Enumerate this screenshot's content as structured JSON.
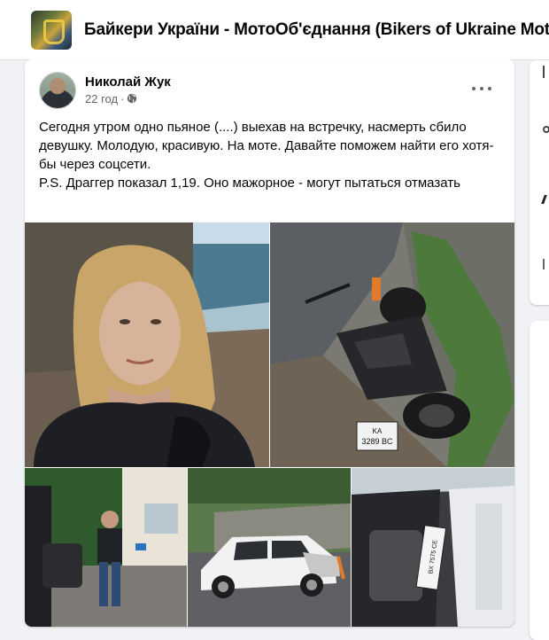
{
  "group": {
    "name": "Байкери України - МотоОб'єднання (Bikers of Ukraine Moto"
  },
  "post": {
    "author": "Николай Жук",
    "time": "22 год",
    "separator": "·",
    "audience_icon": "globe-icon",
    "text_lines": [
      "Сегодня утром одно пьяное (....) выехав на встречку, насмерть сбило девушку. Молодую, красивую. На моте. Давайте поможем найти его хотя-бы через соцсети.",
      "P.S. Драггер показал 1,19. Оно мажорное - могут пытаться отмазать"
    ],
    "photos": [
      {
        "name": "photo-woman-selfie",
        "alt": "Woman selfie by the sea"
      },
      {
        "name": "photo-crashed-motorcycle",
        "alt": "Crashed motorcycle by the road",
        "plate": "KA 3289 BC"
      },
      {
        "name": "photo-man-standing",
        "alt": "Man standing near building"
      },
      {
        "name": "photo-crashed-car",
        "alt": "Damaged white SUV on road"
      },
      {
        "name": "photo-car-interior",
        "alt": "Car interior with plate",
        "plate": "BX 7575 CE"
      }
    ]
  },
  "colors": {
    "background": "#f0f2f5",
    "card": "#ffffff",
    "text_primary": "#050505",
    "text_secondary": "#65676b"
  }
}
